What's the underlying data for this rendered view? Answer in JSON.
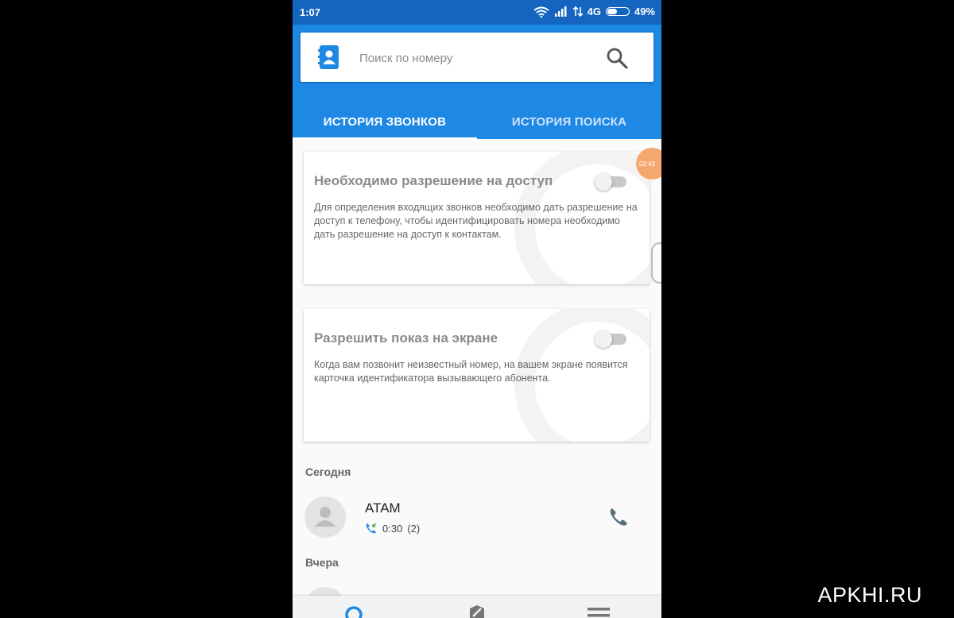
{
  "status_bar": {
    "time": "1:07",
    "network": "4G",
    "battery_percent": "49%",
    "battery_level": 0.49
  },
  "search": {
    "placeholder": "Поиск по номеру",
    "value": ""
  },
  "tabs": [
    {
      "label": "ИСТОРИЯ ЗВОНКОВ",
      "active": true
    },
    {
      "label": "ИСТОРИЯ ПОИСКА",
      "active": false
    }
  ],
  "cards": [
    {
      "title": "Необходимо разрешение на доступ",
      "text": "Для определения входящих звонков необходимо дать разрешение на доступ к телефону, чтобы идентифицировать номера необходимо дать разрешение на доступ к контактам.",
      "toggle_on": false
    },
    {
      "title": "Разрешить показ на экране",
      "text": "Когда вам позвонит неизвестный номер, на вашем экране появится карточка идентификатора вызывающего абонента.",
      "toggle_on": false
    }
  ],
  "sections": {
    "today": "Сегодня",
    "yesterday": "Вчера"
  },
  "calls": [
    {
      "name": "ATAM",
      "duration": "0:30",
      "count": "(2)"
    }
  ],
  "overlay": {
    "bubble_time": "02:43"
  },
  "site_watermark": "APKHI.RU",
  "colors": {
    "primary": "#1e88e5",
    "status_bar": "#1565c0",
    "accent_bubble": "#f5a86d",
    "call_icon": "#546e7a"
  },
  "icons": {
    "contacts": "contacts-book-icon",
    "search": "search-icon",
    "call": "phone-icon",
    "incoming": "incoming-call-icon"
  }
}
